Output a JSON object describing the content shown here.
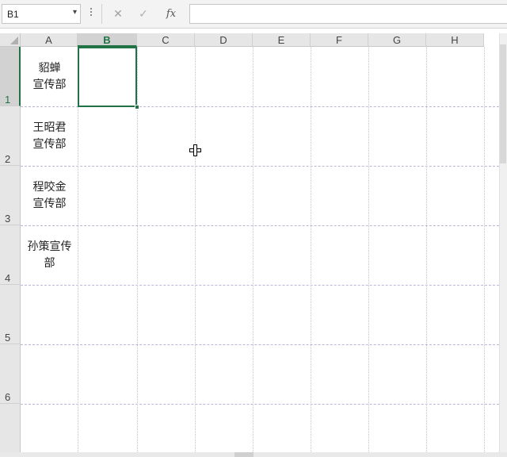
{
  "name_box": {
    "value": "B1",
    "dropdown_icon": "chevron-down-icon"
  },
  "formula_bar": {
    "cancel_icon": "close-icon",
    "enter_icon": "checkmark-icon",
    "fx_label": "fx",
    "value": ""
  },
  "columns": [
    "A",
    "B",
    "C",
    "D",
    "E",
    "F",
    "G",
    "H"
  ],
  "selected_column": "B",
  "rows": [
    "1",
    "2",
    "3",
    "4",
    "5",
    "6"
  ],
  "selected_row": "1",
  "cells_a": [
    {
      "line1": "貂蝉",
      "line2": "宣传部"
    },
    {
      "line1": "王昭君",
      "line2": "宣传部"
    },
    {
      "line1": "程咬金",
      "line2": "宣传部"
    },
    {
      "line1": "孙策宣传",
      "line2": "部"
    }
  ],
  "colors": {
    "accent": "#217346",
    "header_bg": "#e6e6e6"
  }
}
